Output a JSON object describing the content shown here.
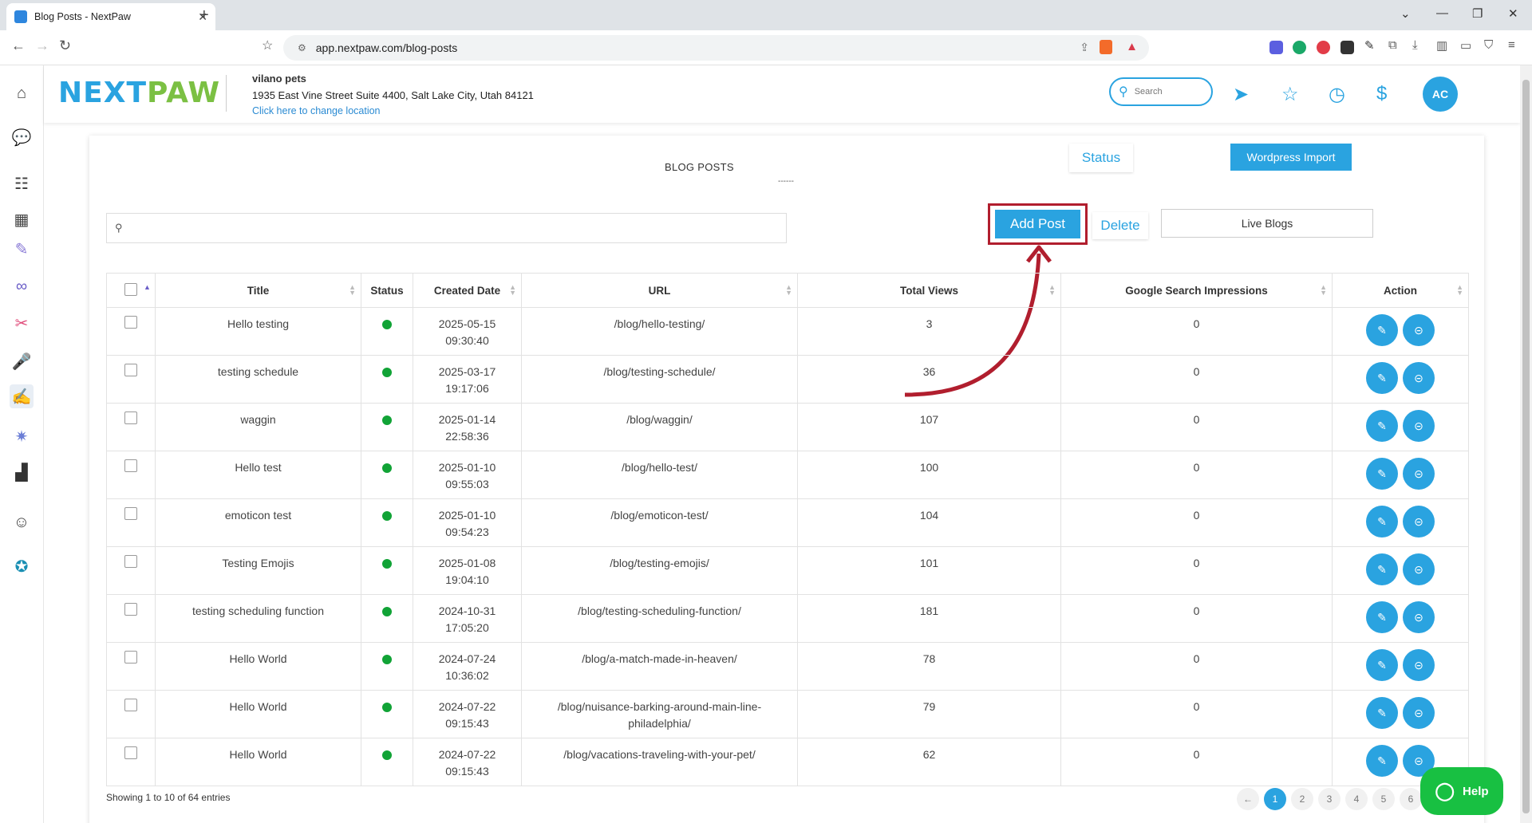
{
  "browser": {
    "tab_title": "Blog Posts - NextPaw",
    "url": "app.nextpaw.com/blog-posts"
  },
  "header": {
    "logo_next": "NEXT",
    "logo_paw": "PAW",
    "business_name": "vilano pets",
    "address": "1935 East Vine Street Suite 4400, Salt Lake City, Utah 84121",
    "change_location": "Click here to change location",
    "search_placeholder": "Search",
    "avatar_initials": "AC"
  },
  "page": {
    "title": "BLOG POSTS",
    "title_underline": "------",
    "status_tab": "Status",
    "wordpress_import": "Wordpress Import",
    "add_post": "Add Post",
    "delete": "Delete",
    "live_filter": "Live Blogs"
  },
  "table": {
    "columns": [
      "Title",
      "Status",
      "Created Date",
      "URL",
      "Total Views",
      "Google Search Impressions",
      "Action"
    ],
    "rows": [
      {
        "title": "Hello testing",
        "date": "2025-05-15",
        "time": "09:30:40",
        "url": "/blog/hello-testing/",
        "url2": "",
        "views": "3",
        "impressions": "0"
      },
      {
        "title": "testing schedule",
        "date": "2025-03-17",
        "time": "19:17:06",
        "url": "/blog/testing-schedule/",
        "url2": "",
        "views": "36",
        "impressions": "0"
      },
      {
        "title": "waggin",
        "date": "2025-01-14",
        "time": "22:58:36",
        "url": "/blog/waggin/",
        "url2": "",
        "views": "107",
        "impressions": "0"
      },
      {
        "title": "Hello test",
        "date": "2025-01-10",
        "time": "09:55:03",
        "url": "/blog/hello-test/",
        "url2": "",
        "views": "100",
        "impressions": "0"
      },
      {
        "title": "emoticon test",
        "date": "2025-01-10",
        "time": "09:54:23",
        "url": "/blog/emoticon-test/",
        "url2": "",
        "views": "104",
        "impressions": "0"
      },
      {
        "title": "Testing Emojis",
        "date": "2025-01-08",
        "time": "19:04:10",
        "url": "/blog/testing-emojis/",
        "url2": "",
        "views": "101",
        "impressions": "0"
      },
      {
        "title": "testing scheduling function",
        "date": "2024-10-31",
        "time": "17:05:20",
        "url": "/blog/testing-scheduling-function/",
        "url2": "",
        "views": "181",
        "impressions": "0"
      },
      {
        "title": "Hello World",
        "date": "2024-07-24",
        "time": "10:36:02",
        "url": "/blog/a-match-made-in-heaven/",
        "url2": "",
        "views": "78",
        "impressions": "0"
      },
      {
        "title": "Hello World",
        "date": "2024-07-22",
        "time": "09:15:43",
        "url": "/blog/nuisance-barking-around-main-line-",
        "url2": "philadelphia/",
        "views": "79",
        "impressions": "0"
      },
      {
        "title": "Hello World",
        "date": "2024-07-22",
        "time": "09:15:43",
        "url": "/blog/vacations-traveling-with-your-pet/",
        "url2": "",
        "views": "62",
        "impressions": "0"
      }
    ]
  },
  "footer": {
    "entries": "Showing 1 to 10 of 64 entries",
    "pages": [
      "←",
      "1",
      "2",
      "3",
      "4",
      "5",
      "6"
    ],
    "help": "Help"
  },
  "colors": {
    "accent": "#2aa3e0",
    "brand_green": "#7bc043",
    "highlight": "#b11e2e",
    "status_live": "#11a336",
    "help_green": "#18c042"
  }
}
